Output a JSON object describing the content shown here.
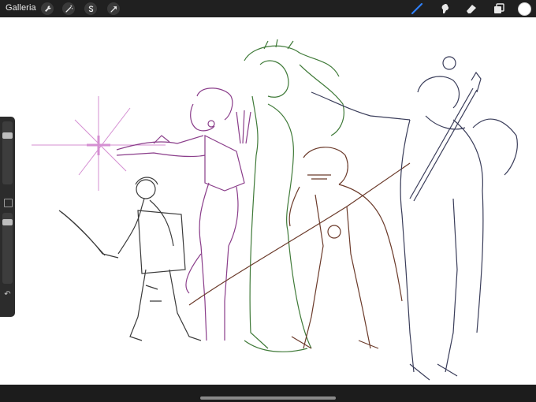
{
  "app": {
    "gallery_label": "Galleria"
  },
  "toolbar": {
    "left_tools": [
      {
        "icon": "wrench-icon"
      },
      {
        "icon": "magic-wand-icon"
      },
      {
        "icon": "selection-icon"
      },
      {
        "icon": "transform-arrow-icon"
      }
    ],
    "right_tools": [
      {
        "icon": "brush-icon",
        "active": true
      },
      {
        "icon": "smudge-icon"
      },
      {
        "icon": "eraser-icon"
      },
      {
        "icon": "layers-icon"
      }
    ],
    "current_color": "#ffffff"
  },
  "sidebar": {
    "brush_size": 0.85,
    "opacity": 0.85
  },
  "colors": {
    "accent": "#2f7ff5",
    "sketch_dark": "#3a3a3a",
    "sketch_purple": "#8a3d8a",
    "sketch_green": "#3f7a38",
    "sketch_brown": "#6b3a2a",
    "sketch_navy": "#3a3d5a",
    "sparkle_pink": "#d58fd2"
  }
}
